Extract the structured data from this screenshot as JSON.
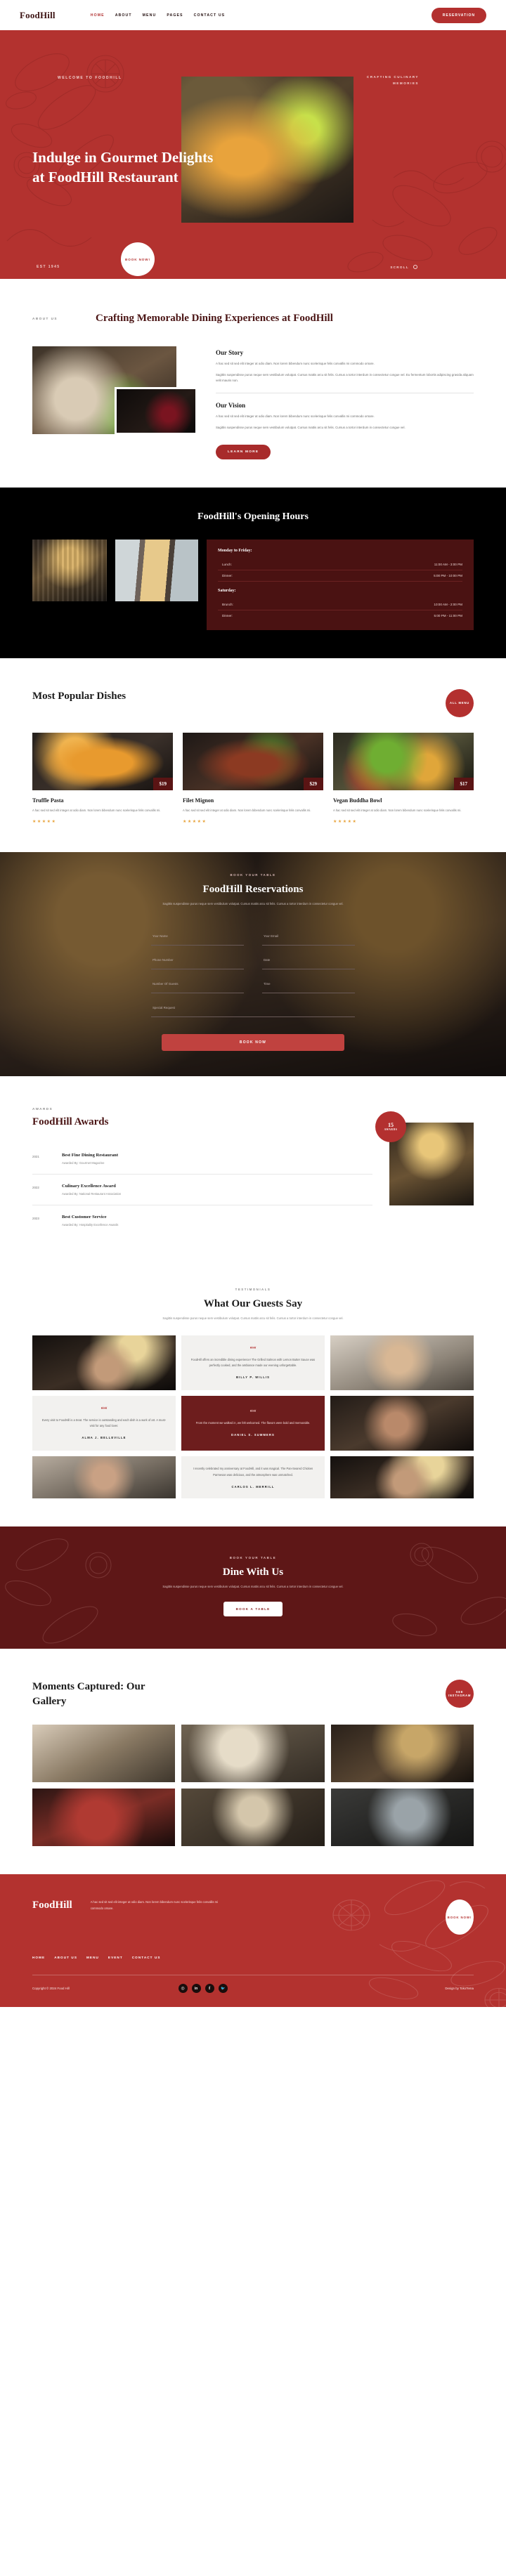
{
  "nav": {
    "logo": "FoodHill",
    "links": [
      {
        "label": "HOME",
        "active": true
      },
      {
        "label": "ABOUT",
        "active": false
      },
      {
        "label": "MENU",
        "active": false
      },
      {
        "label": "PAGES",
        "active": false
      },
      {
        "label": "CONTACT US",
        "active": false
      }
    ],
    "cta": "RESERVATION"
  },
  "hero": {
    "eyebrow": "WELCOME TO FOODHILL",
    "tagline": "CRAFTING CULINARY MEMORIES",
    "title": "Indulge in Gourmet Delights at FoodHill Restaurant",
    "est": "EST 1945",
    "book": "BOOK NOW!",
    "scroll": "SCROLL"
  },
  "about": {
    "eyebrow": "ABOUT US",
    "title": "Crafting Memorable Dining Experiences at FoodHill",
    "story_heading": "Our Story",
    "story_p1": "A hac sed sit sed elit integer at odio diam. Non lorem bibendum nunc scelerisque felis convallis mi commodo ornare.",
    "story_p2": "Sagittis suspendisse purus neque sem vestibulum volutpat. Cursus mattis arcu sit felis. Cursus a tortor interdum in consectetur congue vel. Eu fermentum lobortis adipiscing gravida aliquam velit mauris non.",
    "vision_heading": "Our Vision",
    "vision_p1": "A hac sed sit sed elit integer at odio diam. Non lorem bibendum nunc scelerisque felis convallis mi commodo ornare.",
    "vision_p2": "Sagittis suspendisse purus neque sem vestibulum volutpat. Cursus mattis arcu sit felis. Cursus a tortor interdum in consectetur congue vel.",
    "learn_more": "LEARN MORE"
  },
  "hours": {
    "title": "FoodHill's Opening Hours",
    "groups": [
      {
        "day": "Monday to Friday:",
        "rows": [
          {
            "label": "Lunch:",
            "time": "11:00 AM - 3:00 PM"
          },
          {
            "label": "Dinner:",
            "time": "5:00 PM - 10:00 PM"
          }
        ]
      },
      {
        "day": "Saturday:",
        "rows": [
          {
            "label": "Brunch:",
            "time": "10:00 AM - 2:00 PM"
          },
          {
            "label": "Dinner:",
            "time": "5:00 PM - 11:00 PM"
          }
        ]
      }
    ]
  },
  "dishes": {
    "title": "Most Popular Dishes",
    "all_menu": "ALL MENU",
    "items": [
      {
        "name": "Truffle Pasta",
        "price": "$19",
        "desc": "A hac sed sit sed elit integer at odio diam. Non lorem bibendum nunc scelerisque felis convallis mi.",
        "rating": "★★★★★"
      },
      {
        "name": "Filet Mignon",
        "price": "$29",
        "desc": "A hac sed sit sed elit integer at odio diam. Non lorem bibendum nunc scelerisque felis convallis mi.",
        "rating": "★★★★★"
      },
      {
        "name": "Vegan Buddha Bowl",
        "price": "$17",
        "desc": "A hac sed sit sed elit integer at odio diam. Non lorem bibendum nunc scelerisque felis convallis mi.",
        "rating": "★★★★★"
      }
    ]
  },
  "reservation": {
    "eyebrow": "BOOK YOUR TABLE",
    "title": "FoodHill Reservations",
    "subtitle": "Sagittis suspendisse purus neque sem vestibulum volutpat. Cursus mattis arcu sit felis. Cursus a tortor interdum in consectetur congue vel.",
    "fields": [
      {
        "placeholder": "Your Name",
        "full": false
      },
      {
        "placeholder": "Your Email",
        "full": false
      },
      {
        "placeholder": "Phone Number",
        "full": false
      },
      {
        "placeholder": "Date",
        "full": false
      },
      {
        "placeholder": "Number Of Guests",
        "full": false
      },
      {
        "placeholder": "Time",
        "full": false
      },
      {
        "placeholder": "Special Request",
        "full": true
      }
    ],
    "submit": "BOOK NOW"
  },
  "awards": {
    "eyebrow": "AWARDS",
    "title": "FoodHill Awards",
    "badge_number": "15",
    "badge_label": "AWARDS",
    "items": [
      {
        "year": "2021",
        "name": "Best Fine Dining Restaurant",
        "by": "Awarded By: Gourmet Magazine"
      },
      {
        "year": "2022",
        "name": "Culinary Excellence Award",
        "by": "Awarded By: National Restaurant Association"
      },
      {
        "year": "2023",
        "name": "Best Customer Service",
        "by": "Awarded By: Hospitality Excellence Awards"
      }
    ]
  },
  "testimonials": {
    "eyebrow": "TESTIMONIALS",
    "title": "What Our Guests Say",
    "subtitle": "Sagittis suspendisse purus neque sem vestibulum volutpat. Cursus mattis arcu sit felis. Cursus a tortor interdum in consectetur congue vel.",
    "items": [
      {
        "quote": "FoodHill offers an incredible dining experience! The Grilled Salmon with Lemon Butter Sauce was perfectly cooked, and the ambiance made our evening unforgettable.",
        "name": "BILLY P. WILLIS"
      },
      {
        "quote": "I recently celebrated my anniversary at FoodHill, and it was magical. The Pan-Seared Chicken Parmesan was delicious, and the atmosphere was unmatched.",
        "name": "CARLOS L. MERRILL"
      },
      {
        "quote": "Every visit to FoodHill is a treat. The service is outstanding and each dish is a work of art. A must-visit for any food lover.",
        "name": "ALMA J. BELLEVILLE"
      },
      {
        "quote": "From the moment we walked in, we felt welcomed. The flavors were bold and memorable.",
        "name": "DANIEL S. SUMMERS"
      }
    ]
  },
  "dine": {
    "eyebrow": "BOOK YOUR TABLE",
    "title": "Dine With Us",
    "subtitle": "Sagittis suspendisse purus neque sem vestibulum volutpat. Cursus mattis arcu sit felis. Cursus a tortor interdum in consectetur congue vel.",
    "cta": "BOOK A TABLE"
  },
  "gallery": {
    "title": "Moments Captured: Our Gallery",
    "see_instagram": "SEE INSTAGRAM"
  },
  "footer": {
    "logo": "FoodHill",
    "desc": "A hac sed sit sed elit integer at odio diam. Non lorem bibendum nunc scelerisque felis convallis mi commodo ornare.",
    "book": "BOOK NOW!",
    "nav": [
      "HOME",
      "ABOUT US",
      "MENU",
      "EVENT",
      "CONTACT US"
    ],
    "copyright": "Copyright © 2024 Food Hill",
    "design": "Design by TokoTema",
    "socials": [
      {
        "name": "instagram-icon",
        "glyph": "◎"
      },
      {
        "name": "linkedin-icon",
        "glyph": "in"
      },
      {
        "name": "facebook-icon",
        "glyph": "f"
      },
      {
        "name": "twitter-icon",
        "glyph": "🐦"
      }
    ]
  },
  "colors": {
    "brand_red": "#b3322f",
    "deep_maroon": "#4a1414",
    "dark": "#000000",
    "star_gold": "#e8a33c"
  }
}
